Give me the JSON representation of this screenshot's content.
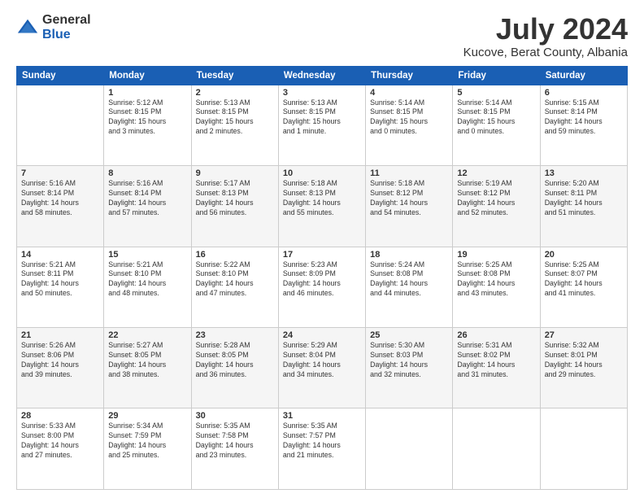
{
  "header": {
    "logo_general": "General",
    "logo_blue": "Blue",
    "title": "July 2024",
    "subtitle": "Kucove, Berat County, Albania"
  },
  "calendar": {
    "days_of_week": [
      "Sunday",
      "Monday",
      "Tuesday",
      "Wednesday",
      "Thursday",
      "Friday",
      "Saturday"
    ],
    "weeks": [
      [
        {
          "day": "",
          "info": ""
        },
        {
          "day": "1",
          "info": "Sunrise: 5:12 AM\nSunset: 8:15 PM\nDaylight: 15 hours\nand 3 minutes."
        },
        {
          "day": "2",
          "info": "Sunrise: 5:13 AM\nSunset: 8:15 PM\nDaylight: 15 hours\nand 2 minutes."
        },
        {
          "day": "3",
          "info": "Sunrise: 5:13 AM\nSunset: 8:15 PM\nDaylight: 15 hours\nand 1 minute."
        },
        {
          "day": "4",
          "info": "Sunrise: 5:14 AM\nSunset: 8:15 PM\nDaylight: 15 hours\nand 0 minutes."
        },
        {
          "day": "5",
          "info": "Sunrise: 5:14 AM\nSunset: 8:15 PM\nDaylight: 15 hours\nand 0 minutes."
        },
        {
          "day": "6",
          "info": "Sunrise: 5:15 AM\nSunset: 8:14 PM\nDaylight: 14 hours\nand 59 minutes."
        }
      ],
      [
        {
          "day": "7",
          "info": "Sunrise: 5:16 AM\nSunset: 8:14 PM\nDaylight: 14 hours\nand 58 minutes."
        },
        {
          "day": "8",
          "info": "Sunrise: 5:16 AM\nSunset: 8:14 PM\nDaylight: 14 hours\nand 57 minutes."
        },
        {
          "day": "9",
          "info": "Sunrise: 5:17 AM\nSunset: 8:13 PM\nDaylight: 14 hours\nand 56 minutes."
        },
        {
          "day": "10",
          "info": "Sunrise: 5:18 AM\nSunset: 8:13 PM\nDaylight: 14 hours\nand 55 minutes."
        },
        {
          "day": "11",
          "info": "Sunrise: 5:18 AM\nSunset: 8:12 PM\nDaylight: 14 hours\nand 54 minutes."
        },
        {
          "day": "12",
          "info": "Sunrise: 5:19 AM\nSunset: 8:12 PM\nDaylight: 14 hours\nand 52 minutes."
        },
        {
          "day": "13",
          "info": "Sunrise: 5:20 AM\nSunset: 8:11 PM\nDaylight: 14 hours\nand 51 minutes."
        }
      ],
      [
        {
          "day": "14",
          "info": "Sunrise: 5:21 AM\nSunset: 8:11 PM\nDaylight: 14 hours\nand 50 minutes."
        },
        {
          "day": "15",
          "info": "Sunrise: 5:21 AM\nSunset: 8:10 PM\nDaylight: 14 hours\nand 48 minutes."
        },
        {
          "day": "16",
          "info": "Sunrise: 5:22 AM\nSunset: 8:10 PM\nDaylight: 14 hours\nand 47 minutes."
        },
        {
          "day": "17",
          "info": "Sunrise: 5:23 AM\nSunset: 8:09 PM\nDaylight: 14 hours\nand 46 minutes."
        },
        {
          "day": "18",
          "info": "Sunrise: 5:24 AM\nSunset: 8:08 PM\nDaylight: 14 hours\nand 44 minutes."
        },
        {
          "day": "19",
          "info": "Sunrise: 5:25 AM\nSunset: 8:08 PM\nDaylight: 14 hours\nand 43 minutes."
        },
        {
          "day": "20",
          "info": "Sunrise: 5:25 AM\nSunset: 8:07 PM\nDaylight: 14 hours\nand 41 minutes."
        }
      ],
      [
        {
          "day": "21",
          "info": "Sunrise: 5:26 AM\nSunset: 8:06 PM\nDaylight: 14 hours\nand 39 minutes."
        },
        {
          "day": "22",
          "info": "Sunrise: 5:27 AM\nSunset: 8:05 PM\nDaylight: 14 hours\nand 38 minutes."
        },
        {
          "day": "23",
          "info": "Sunrise: 5:28 AM\nSunset: 8:05 PM\nDaylight: 14 hours\nand 36 minutes."
        },
        {
          "day": "24",
          "info": "Sunrise: 5:29 AM\nSunset: 8:04 PM\nDaylight: 14 hours\nand 34 minutes."
        },
        {
          "day": "25",
          "info": "Sunrise: 5:30 AM\nSunset: 8:03 PM\nDaylight: 14 hours\nand 32 minutes."
        },
        {
          "day": "26",
          "info": "Sunrise: 5:31 AM\nSunset: 8:02 PM\nDaylight: 14 hours\nand 31 minutes."
        },
        {
          "day": "27",
          "info": "Sunrise: 5:32 AM\nSunset: 8:01 PM\nDaylight: 14 hours\nand 29 minutes."
        }
      ],
      [
        {
          "day": "28",
          "info": "Sunrise: 5:33 AM\nSunset: 8:00 PM\nDaylight: 14 hours\nand 27 minutes."
        },
        {
          "day": "29",
          "info": "Sunrise: 5:34 AM\nSunset: 7:59 PM\nDaylight: 14 hours\nand 25 minutes."
        },
        {
          "day": "30",
          "info": "Sunrise: 5:35 AM\nSunset: 7:58 PM\nDaylight: 14 hours\nand 23 minutes."
        },
        {
          "day": "31",
          "info": "Sunrise: 5:35 AM\nSunset: 7:57 PM\nDaylight: 14 hours\nand 21 minutes."
        },
        {
          "day": "",
          "info": ""
        },
        {
          "day": "",
          "info": ""
        },
        {
          "day": "",
          "info": ""
        }
      ]
    ]
  }
}
